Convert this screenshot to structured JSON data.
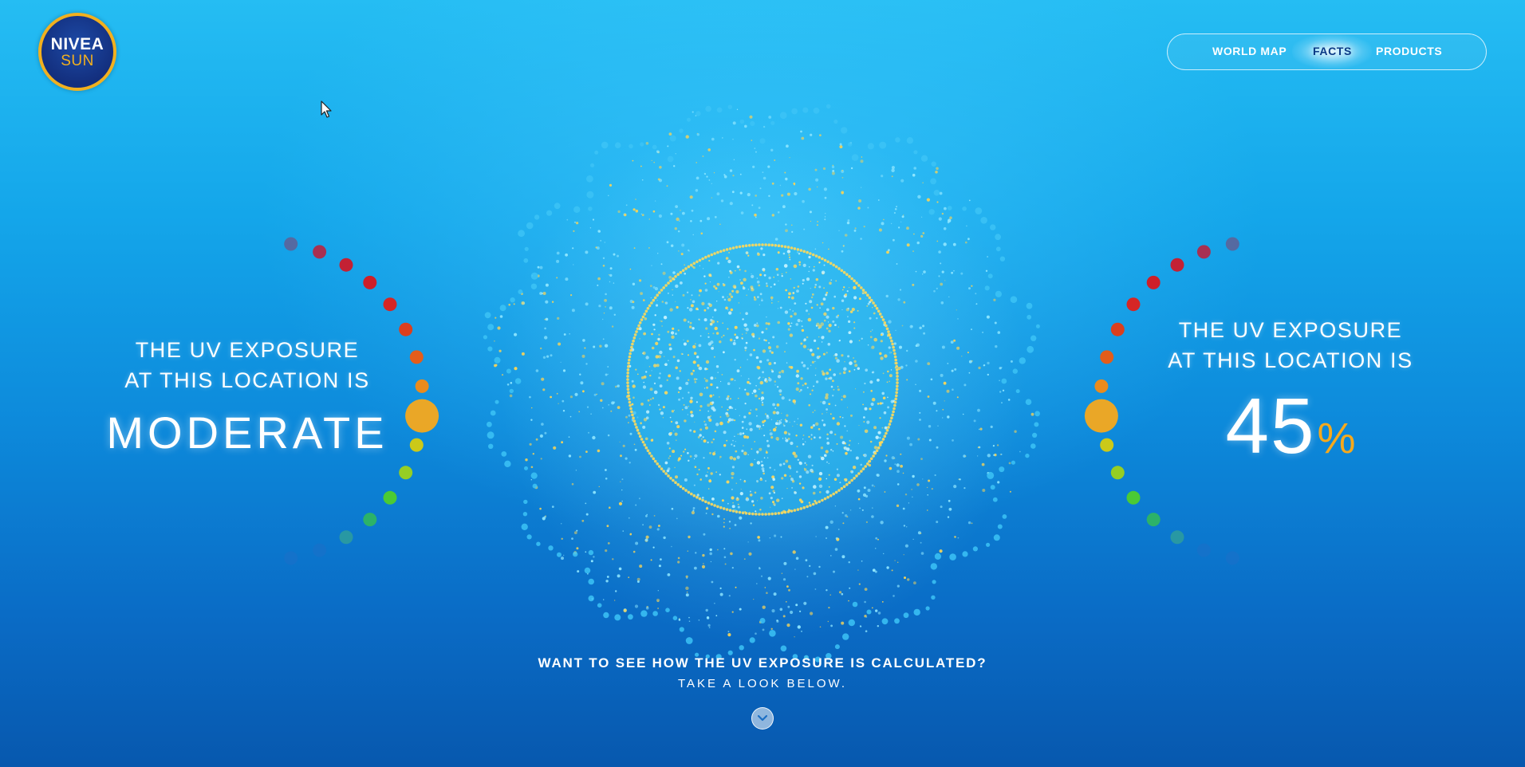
{
  "logo": {
    "brand": "NIVEA",
    "sub": "SUN"
  },
  "nav": {
    "items": [
      {
        "label": "WORLD MAP"
      },
      {
        "label": "FACTS",
        "active": true
      },
      {
        "label": "PRODUCTS"
      }
    ]
  },
  "left_panel": {
    "title_line1": "THE UV EXPOSURE",
    "title_line2": "AT THIS LOCATION IS",
    "level": "MODERATE"
  },
  "right_panel": {
    "title_line1": "THE UV EXPOSURE",
    "title_line2": "AT THIS LOCATION IS",
    "value": "45",
    "unit": "%"
  },
  "uv_exposure_percent": 45,
  "cta": {
    "question": "WANT TO SEE HOW THE UV EXPOSURE IS CALCULATED?",
    "hint": "TAKE A LOOK BELOW."
  },
  "icons": {
    "scroll": "chevron-down-icon",
    "cursor": "mouse-pointer-icon"
  },
  "colors": {
    "accent": "#f7a91c",
    "logo_gold": "#f2b01e",
    "logo_blue": "#132f7e",
    "uv_scale": [
      "#1e6fc9",
      "#1e6fc9",
      "#2a9aa0",
      "#2eb563",
      "#4fcf2c",
      "#9dd21a",
      "#d6cc0f",
      "#f7a91c",
      "#f58a12",
      "#ee5a10",
      "#e63a12",
      "#e0201a",
      "#d8181f",
      "#cc1a2a",
      "#b02a4a",
      "#8a3a66"
    ]
  }
}
